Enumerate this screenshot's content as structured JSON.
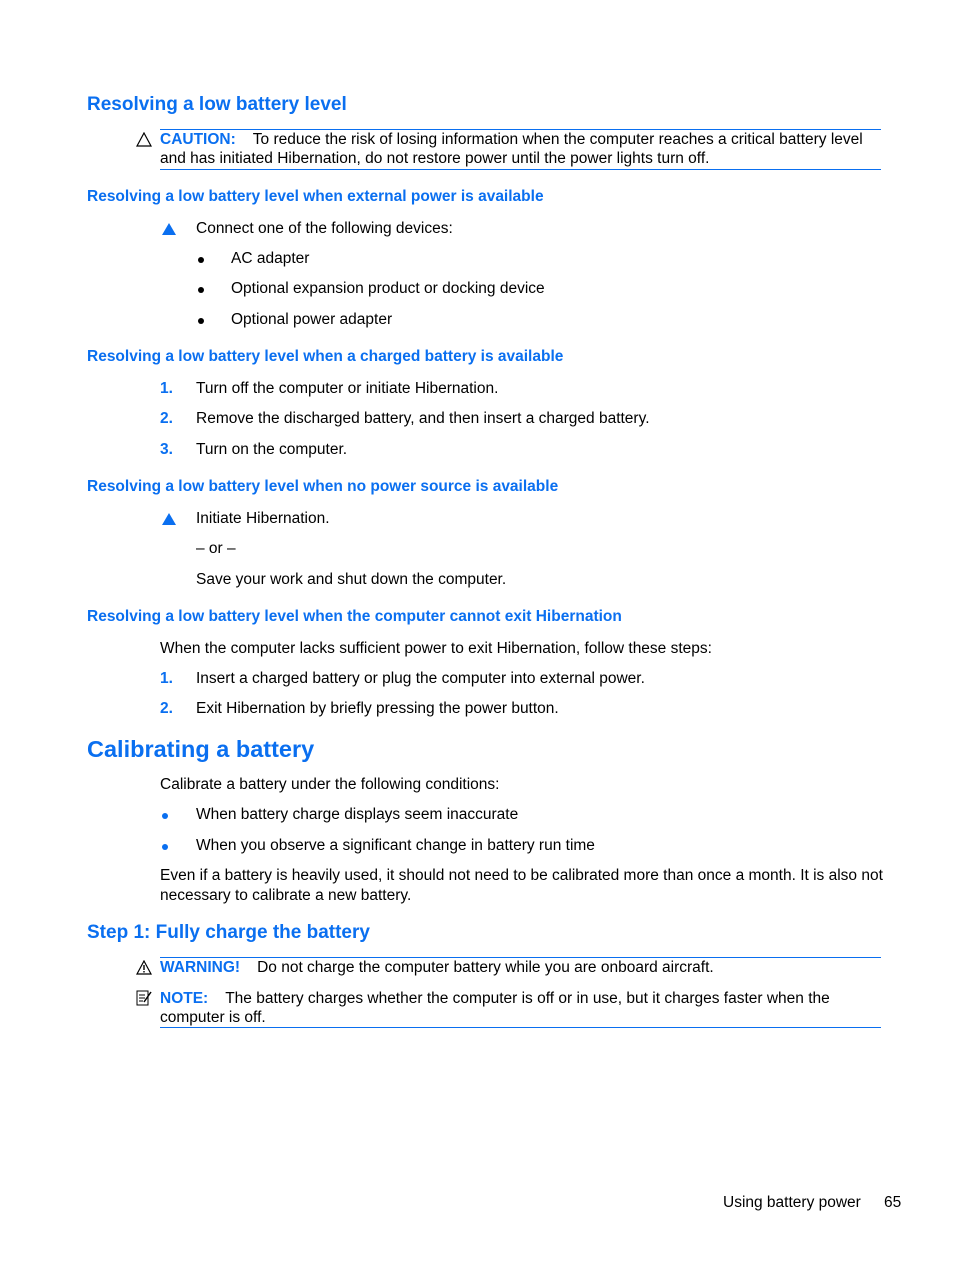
{
  "sections": {
    "low_battery": {
      "title": "Resolving a low battery level",
      "caution": {
        "label": "CAUTION:",
        "line1": "To reduce the risk of losing information when the computer reaches a critical battery level",
        "line2": "and has initiated Hibernation, do not restore power until the power lights turn off."
      },
      "external": {
        "title": "Resolving a low battery level when external power is available",
        "step": "Connect one of the following devices:",
        "items": [
          "AC adapter",
          "Optional expansion product or docking device",
          "Optional power adapter"
        ]
      },
      "charged": {
        "title": "Resolving a low battery level when a charged battery is available",
        "steps": [
          {
            "num": "1.",
            "text": "Turn off the computer or initiate Hibernation."
          },
          {
            "num": "2.",
            "text": "Remove the discharged battery, and then insert a charged battery."
          },
          {
            "num": "3.",
            "text": "Turn on the computer."
          }
        ]
      },
      "no_power": {
        "title": "Resolving a low battery level when no power source is available",
        "step": "Initiate Hibernation.",
        "or": "– or –",
        "alt": "Save your work and shut down the computer."
      },
      "cannot_exit": {
        "title": "Resolving a low battery level when the computer cannot exit Hibernation",
        "intro": "When the computer lacks sufficient power to exit Hibernation, follow these steps:",
        "steps": [
          {
            "num": "1.",
            "text": "Insert a charged battery or plug the computer into external power."
          },
          {
            "num": "2.",
            "text": "Exit Hibernation by briefly pressing the power button."
          }
        ]
      }
    },
    "calibrating": {
      "title": "Calibrating a battery",
      "intro": "Calibrate a battery under the following conditions:",
      "items": [
        "When battery charge displays seem inaccurate",
        "When you observe a significant change in battery run time"
      ],
      "para": "Even if a battery is heavily used, it should not need to be calibrated more than once a month. It is also not necessary to calibrate a new battery.",
      "step1": {
        "title": "Step 1: Fully charge the battery",
        "warning": {
          "label": "WARNING!",
          "text": "Do not charge the computer battery while you are onboard aircraft."
        },
        "note": {
          "label": "NOTE:",
          "line1": "The battery charges whether the computer is off or in use, but it charges faster when the",
          "line2": "computer is off."
        }
      }
    }
  },
  "footer": {
    "section": "Using battery power",
    "page": "65"
  }
}
